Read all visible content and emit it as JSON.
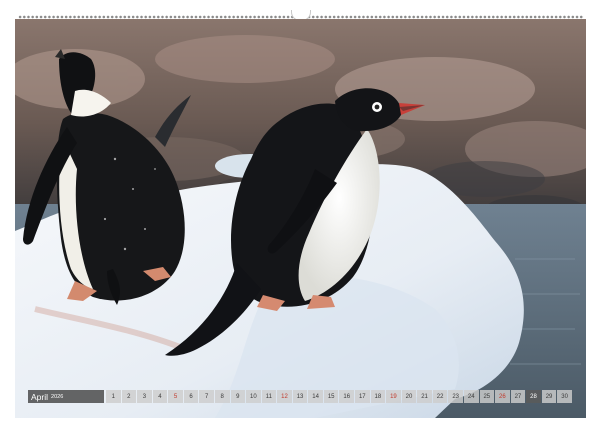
{
  "calendar": {
    "month": "April",
    "year": "2026",
    "days": [
      {
        "n": "1",
        "sunday": false
      },
      {
        "n": "2",
        "sunday": false
      },
      {
        "n": "3",
        "sunday": false
      },
      {
        "n": "4",
        "sunday": false
      },
      {
        "n": "5",
        "sunday": true
      },
      {
        "n": "6",
        "sunday": false
      },
      {
        "n": "7",
        "sunday": false
      },
      {
        "n": "8",
        "sunday": false
      },
      {
        "n": "9",
        "sunday": false
      },
      {
        "n": "10",
        "sunday": false
      },
      {
        "n": "11",
        "sunday": false
      },
      {
        "n": "12",
        "sunday": true
      },
      {
        "n": "13",
        "sunday": false
      },
      {
        "n": "14",
        "sunday": false
      },
      {
        "n": "15",
        "sunday": false
      },
      {
        "n": "16",
        "sunday": false
      },
      {
        "n": "17",
        "sunday": false
      },
      {
        "n": "18",
        "sunday": false
      },
      {
        "n": "19",
        "sunday": true
      },
      {
        "n": "20",
        "sunday": false
      },
      {
        "n": "21",
        "sunday": false
      },
      {
        "n": "22",
        "sunday": false
      },
      {
        "n": "23",
        "sunday": false
      },
      {
        "n": "24",
        "sunday": false
      },
      {
        "n": "25",
        "sunday": false
      },
      {
        "n": "26",
        "sunday": true
      },
      {
        "n": "27",
        "sunday": false
      },
      {
        "n": "28",
        "sunday": false
      },
      {
        "n": "29",
        "sunday": false
      },
      {
        "n": "30",
        "sunday": false
      }
    ],
    "highlighted_day": "28"
  },
  "photo": {
    "subject": "Two Adelie penguins standing on an ice floe",
    "colors": {
      "rock": "#6b5a52",
      "ice": "#eef2f6",
      "water": "#5d6e7a",
      "penguin_black": "#121418",
      "penguin_white": "#f2f1ec",
      "feet": "#d9896f",
      "beak": "#c8403a"
    }
  }
}
